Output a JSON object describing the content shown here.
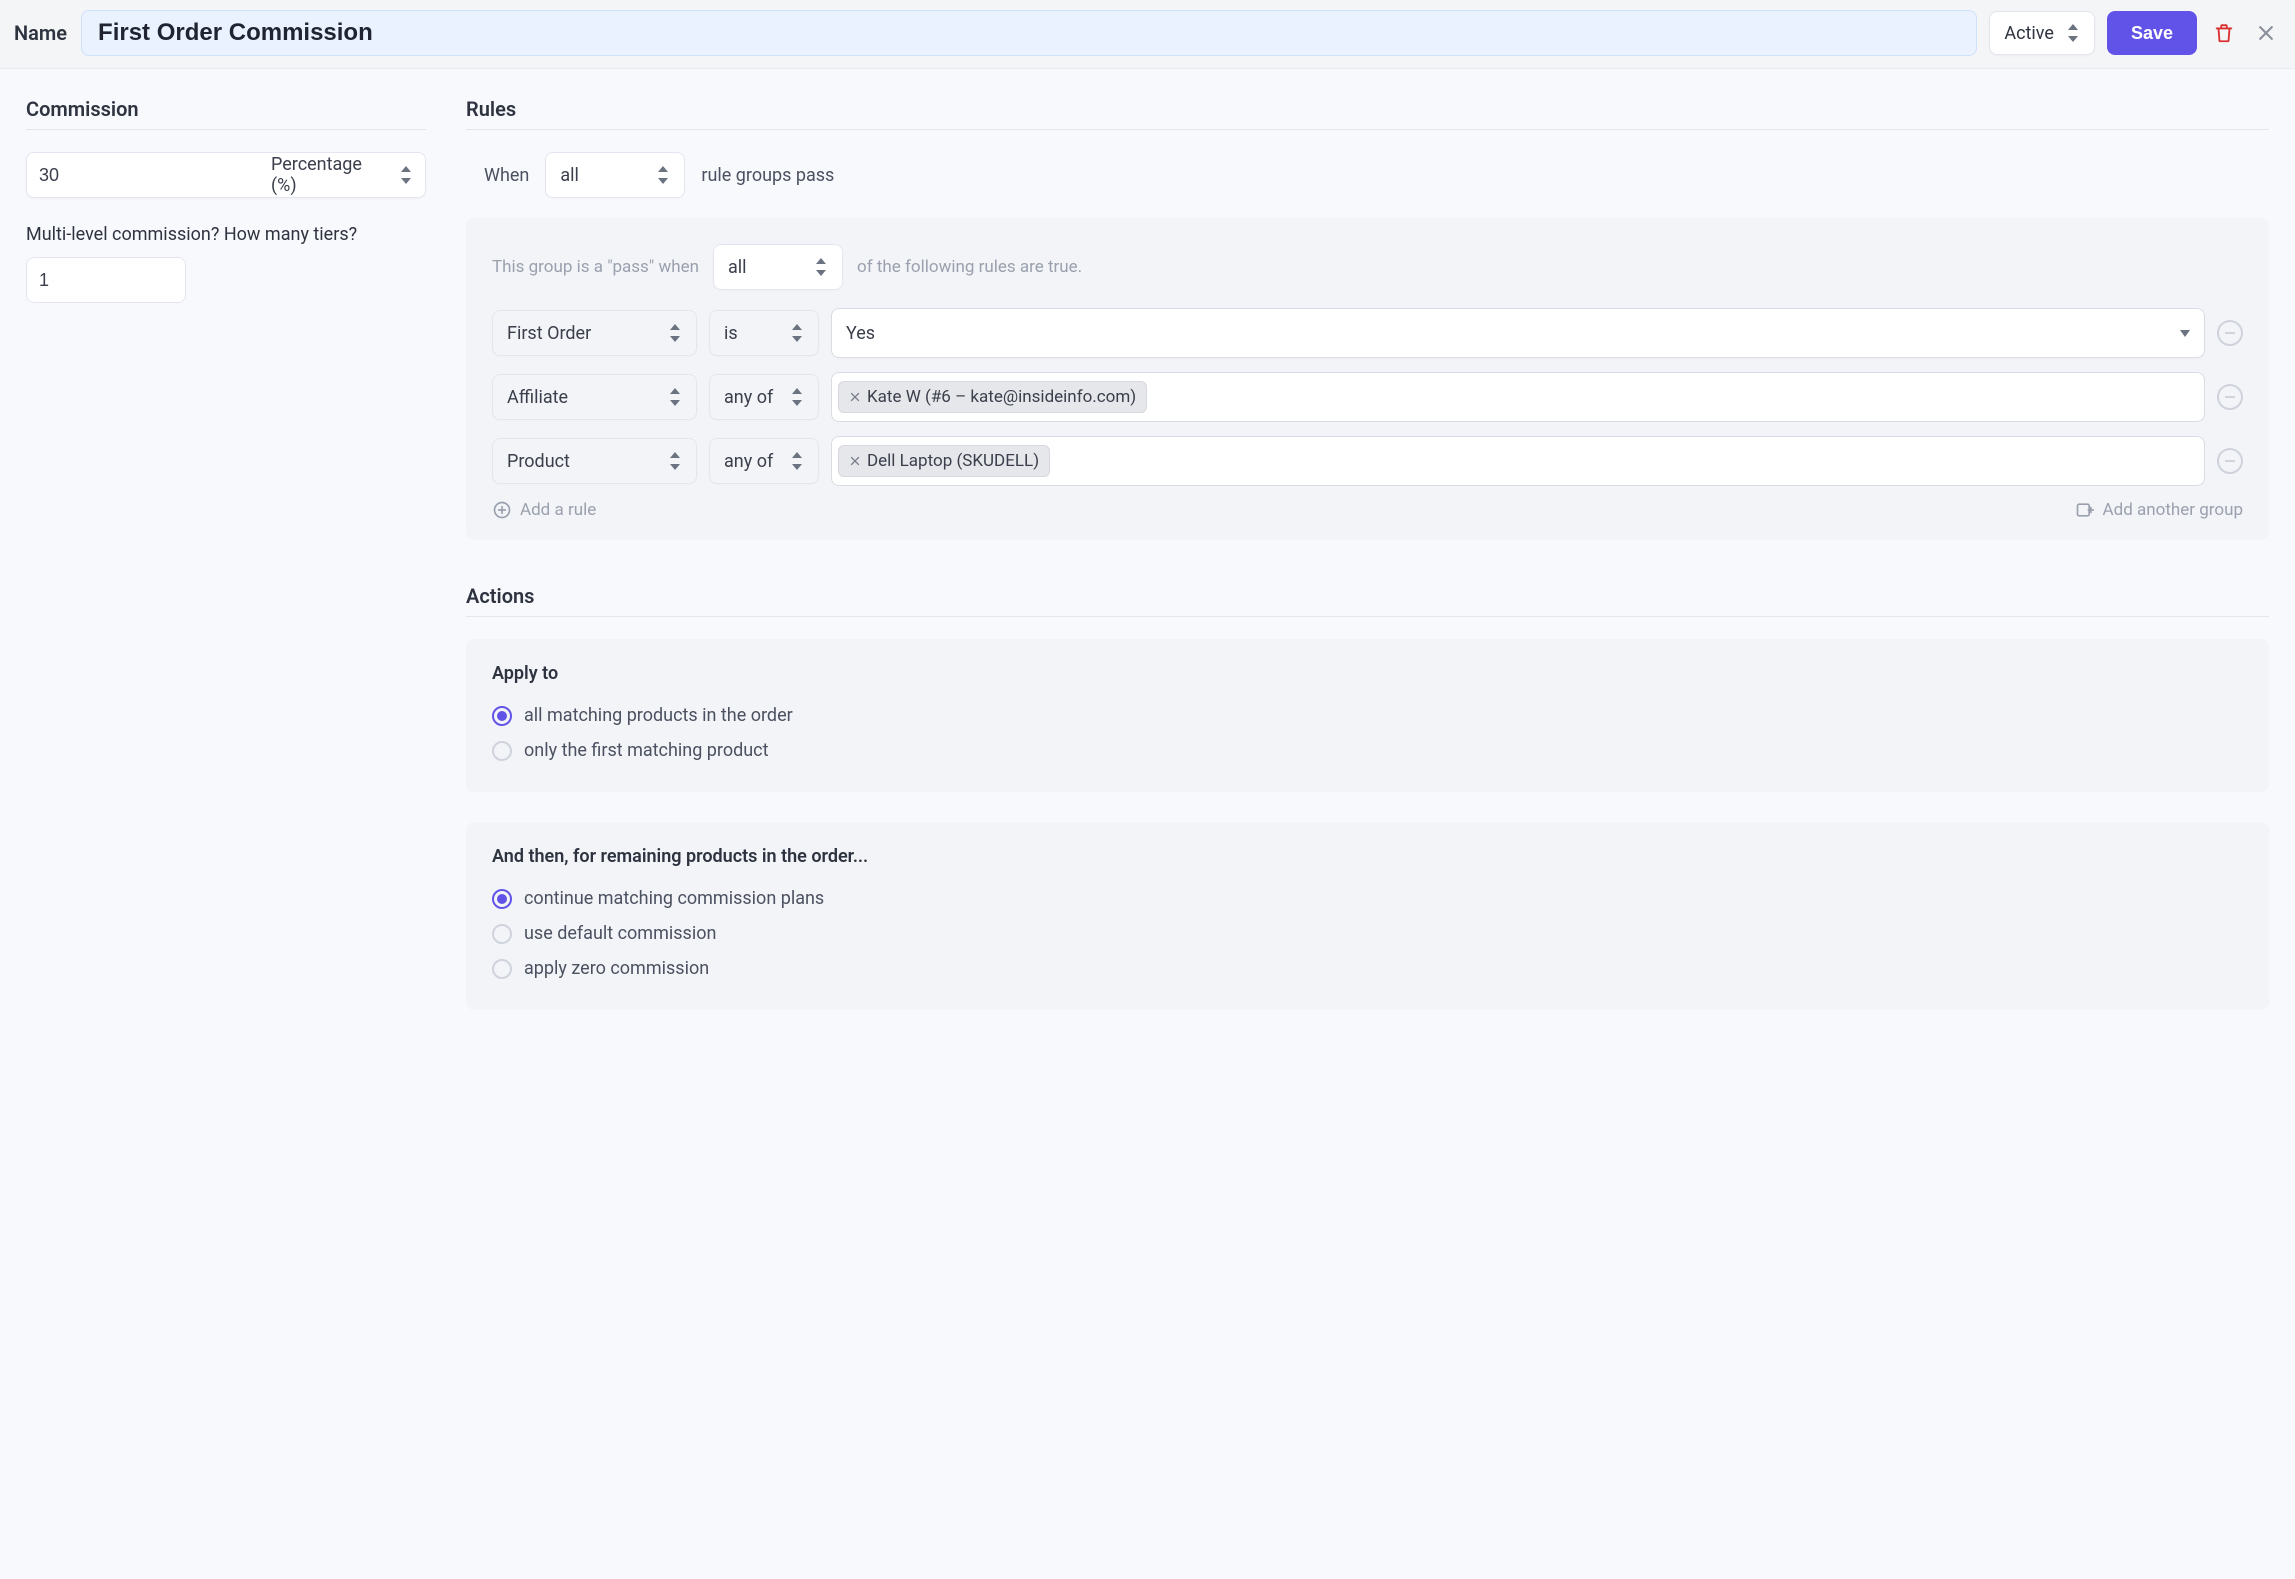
{
  "header": {
    "name_label": "Name",
    "name_value": "First Order Commission",
    "status": "Active",
    "save_label": "Save"
  },
  "commission": {
    "title": "Commission",
    "value": "30",
    "unit_label": "Percentage (%)",
    "multi_tier_label": "Multi-level commission? How many tiers?",
    "tiers_value": "1"
  },
  "rules": {
    "title": "Rules",
    "when_label": "When",
    "when_mode": "all",
    "when_suffix": "rule groups pass",
    "group": {
      "prefix": "This group is a \"pass\" when",
      "mode": "all",
      "suffix": "of the following rules are true.",
      "rows": [
        {
          "field": "First Order",
          "op": "is",
          "value": "Yes"
        },
        {
          "field": "Affiliate",
          "op": "any of",
          "tag": "Kate W (#6 – kate@insideinfo.com)"
        },
        {
          "field": "Product",
          "op": "any of",
          "tag": "Dell Laptop (SKUDELL)"
        }
      ],
      "add_rule_label": "Add a rule",
      "add_group_label": "Add another group"
    }
  },
  "actions": {
    "title": "Actions",
    "apply_to": {
      "heading": "Apply to",
      "options": [
        "all matching products in the order",
        "only the first matching product"
      ],
      "selected": 0
    },
    "remaining": {
      "heading": "And then, for remaining products in the order...",
      "options": [
        "continue matching commission plans",
        "use default commission",
        "apply zero commission"
      ],
      "selected": 0
    }
  }
}
